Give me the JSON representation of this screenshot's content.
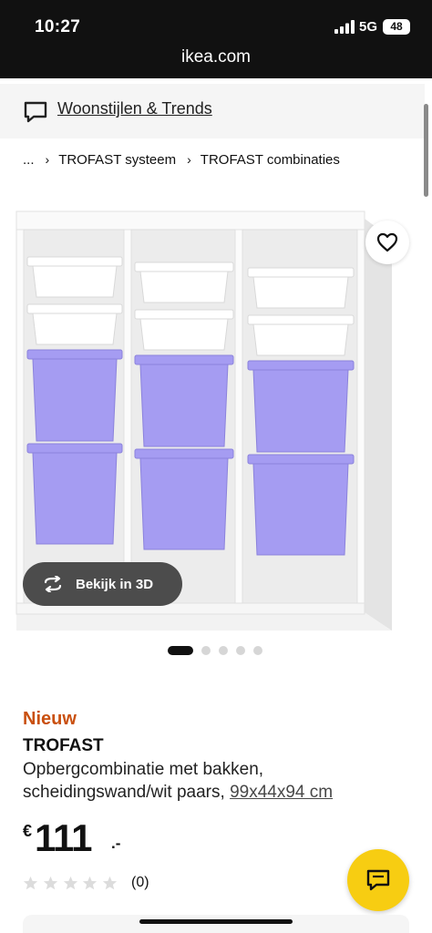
{
  "status_bar": {
    "time": "10:27",
    "network": "5G",
    "battery": "48",
    "url": "ikea.com"
  },
  "banner": {
    "icon": "chat-bubble-icon",
    "link_text": "Woonstijlen & Trends"
  },
  "breadcrumb": {
    "items": [
      "...",
      "TROFAST systeem",
      "TROFAST combinaties"
    ]
  },
  "product_image": {
    "wishlist_icon": "heart-icon",
    "view_3d_label": "Bekijk in 3D",
    "carousel_total": 5,
    "carousel_active": 1
  },
  "product": {
    "badge": "Nieuw",
    "name": "TROFAST",
    "description": "Opbergcombinatie met bakken, scheidingswand/wit paars,",
    "dimensions": "99x44x94 cm",
    "currency": "€",
    "price": "111",
    "price_suffix": ".-",
    "rating_stars": 0,
    "rating_max": 5,
    "rating_count": "(0)"
  },
  "chat_button": {
    "icon": "chat-icon"
  },
  "colors": {
    "badge_new": "#c9500f",
    "chat_button": "#f7cd12",
    "bin_purple": "#a59cf2",
    "bin_white": "#ffffff"
  }
}
